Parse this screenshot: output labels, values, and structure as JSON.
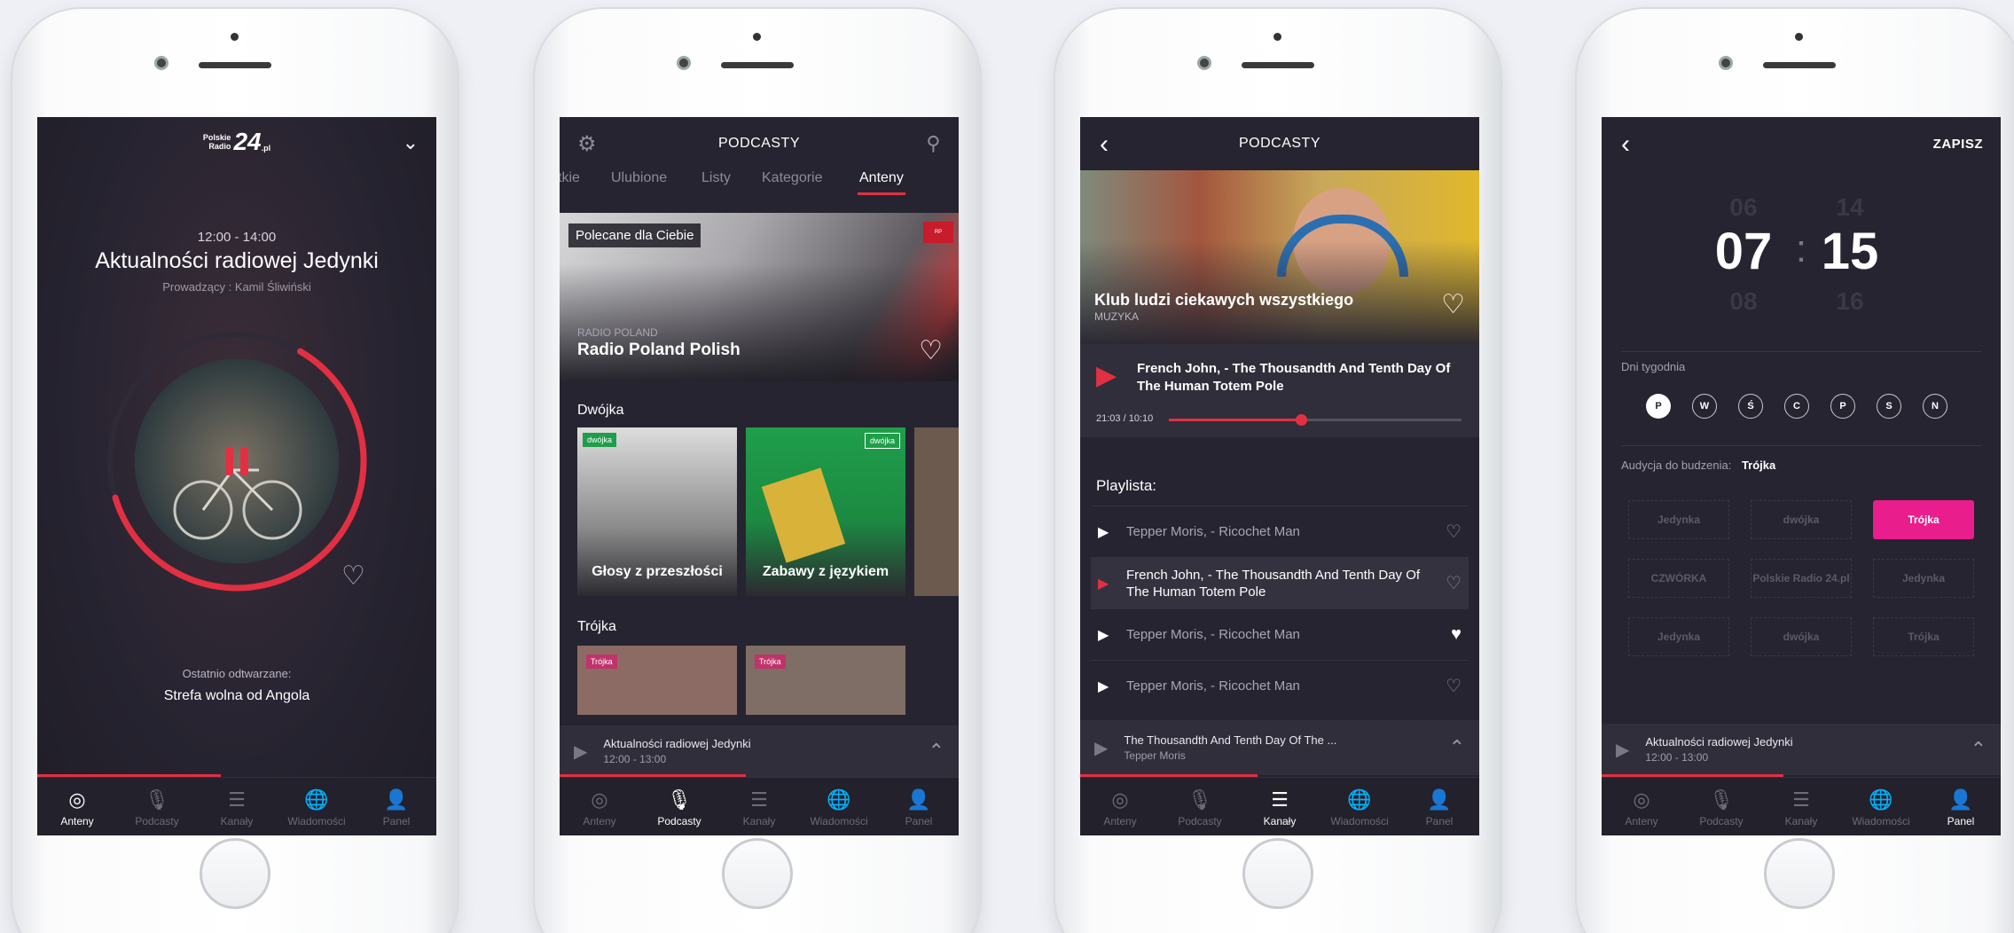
{
  "colors": {
    "accent": "#e23042",
    "screen_bg": "#262430",
    "pink": "#e91e8c"
  },
  "nav": [
    "Anteny",
    "Podcasty",
    "Kanały",
    "Wiadomości",
    "Panel"
  ],
  "screen1": {
    "logo_line1": "Polskie",
    "logo_line2": "Radio",
    "logo_num": "24",
    "logo_suffix": ".pl",
    "time": "12:00 - 14:00",
    "title": "Aktualności radiowej Jedynki",
    "host": "Prowadzący : Kamil Śliwiński",
    "recent_label": "Ostatnio odtwarzane:",
    "recent_title": "Strefa wolna od Angola",
    "progress": 0.62
  },
  "screen2": {
    "title": "PODCASTY",
    "tabs": [
      "tkie",
      "Ulubione",
      "Listy",
      "Kategorie",
      "Anteny"
    ],
    "active_tab": "Anteny",
    "hero_badge": "Polecane dla Ciebie",
    "hero_station": "RADIO POLAND",
    "hero_title": "Radio Poland Polish",
    "section1": "Dwójka",
    "cards1": [
      "Głosy z przeszłości",
      "Zabawy z językiem"
    ],
    "section2": "Trójka",
    "mini_title": "Aktualności radiowej Jedynki",
    "mini_time": "12:00 - 13:00"
  },
  "screen3": {
    "title": "PODCASTY",
    "hero_title": "Klub ludzi ciekawych wszystkiego",
    "hero_category": "MUZYKA",
    "now_playing": "French John, - The Thousandth And Tenth Day Of The Human Totem Pole",
    "time": "21:03 / 10:10",
    "progress": 0.45,
    "playlist_label": "Playlista:",
    "playlist": [
      {
        "title": "Tepper Moris, - Ricochet Man",
        "active": false,
        "liked": false
      },
      {
        "title": "French John, - The Thousandth And Tenth Day Of The Human Totem Pole",
        "active": true,
        "liked": false
      },
      {
        "title": "Tepper Moris, - Ricochet Man",
        "active": false,
        "liked": true
      },
      {
        "title": "Tepper Moris, - Ricochet Man",
        "active": false,
        "liked": false
      }
    ],
    "mini_title": "The Thousandth And Tenth Day Of The ...",
    "mini_artist": "Tepper Moris"
  },
  "screen4": {
    "save": "ZAPISZ",
    "hour_prev": "06",
    "hour": "07",
    "hour_next": "08",
    "min_prev": "14",
    "min": "15",
    "min_next": "16",
    "colon": ":",
    "days_label": "Dni tygodnia",
    "days": [
      "P",
      "W",
      "Ś",
      "C",
      "P",
      "S",
      "N"
    ],
    "wake_label": "Audycja do budzenia:",
    "wake_value": "Trójka",
    "stations": [
      "Jedynka",
      "dwójka",
      "Trójka",
      "CZWÓRKA",
      "Polskie Radio 24.pl",
      "Jedynka",
      "Jedynka",
      "dwójka",
      "Trójka"
    ],
    "mini_title": "Aktualności radiowej Jedynki",
    "mini_time": "12:00 - 13:00"
  }
}
